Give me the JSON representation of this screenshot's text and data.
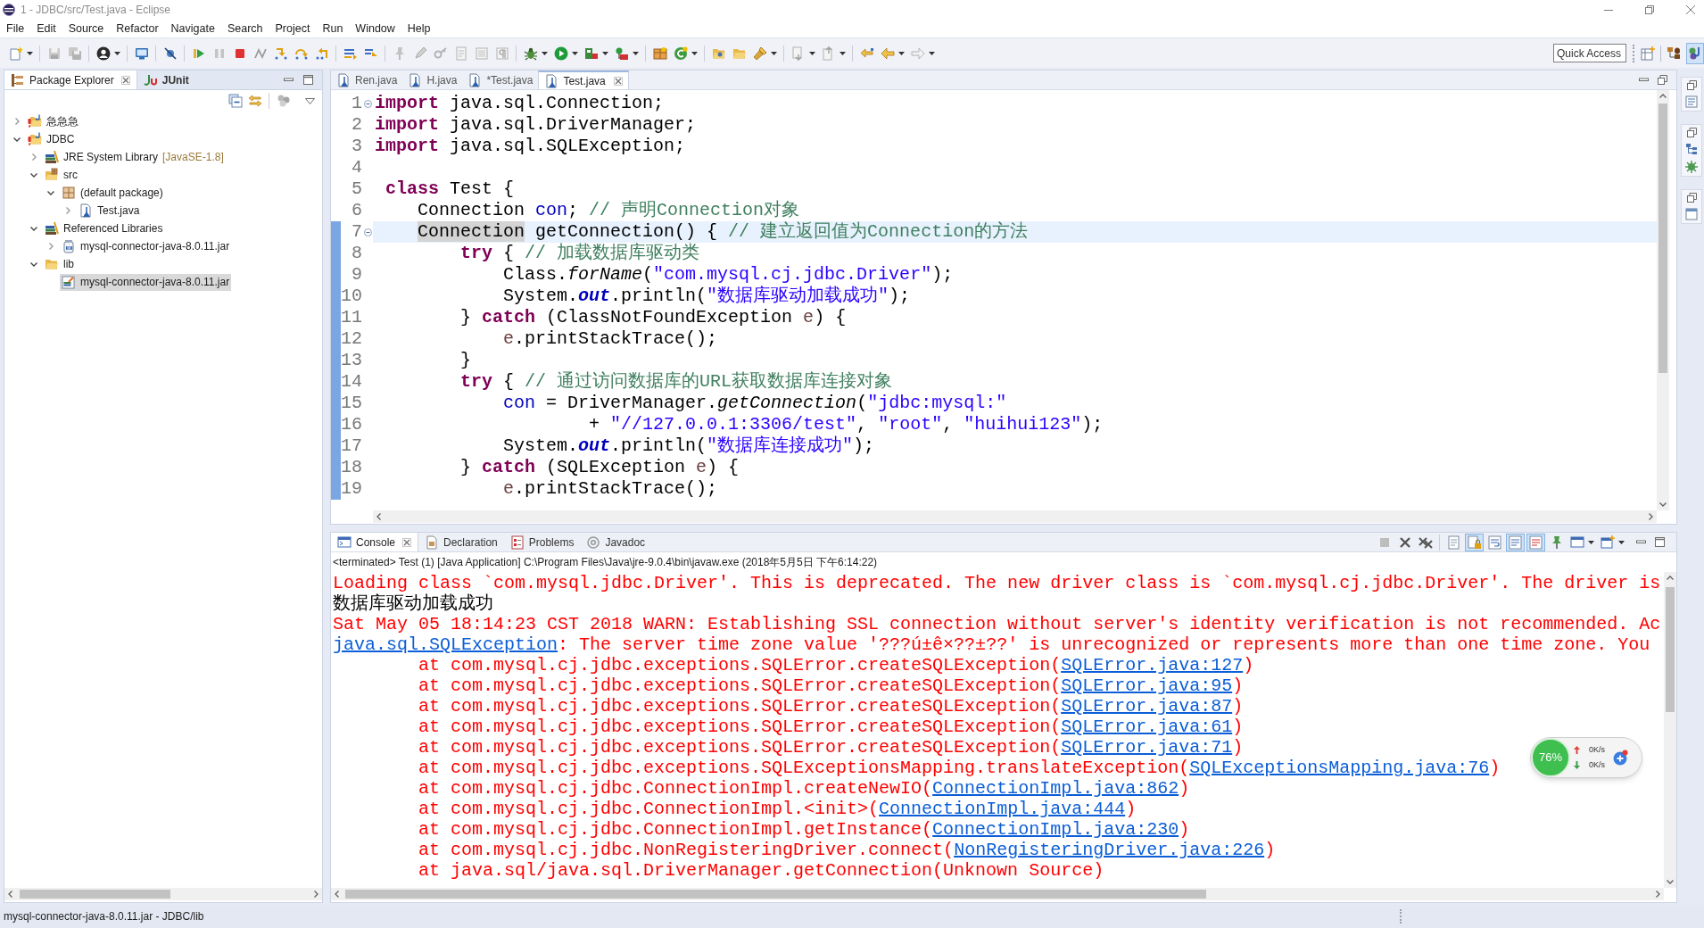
{
  "window": {
    "title": "1 - JDBC/src/Test.java - Eclipse"
  },
  "menu": [
    "File",
    "Edit",
    "Source",
    "Refactor",
    "Navigate",
    "Search",
    "Project",
    "Run",
    "Window",
    "Help"
  ],
  "quick_access": {
    "placeholder": "Quick Access"
  },
  "perspectives": [
    {
      "kind": "debug",
      "selected": false
    },
    {
      "kind": "java",
      "selected": true
    }
  ],
  "package_explorer": {
    "tabs": [
      {
        "kind": "package_explorer",
        "label": "Package Explorer",
        "selected": true,
        "bold": false
      },
      {
        "kind": "junit",
        "label": "JUnit",
        "selected": false,
        "bold": true
      }
    ],
    "tree": [
      {
        "label": "急急急",
        "kind": "project",
        "expandable": true,
        "expanded": false,
        "selected": false
      },
      {
        "label": "JDBC",
        "kind": "project",
        "expandable": true,
        "expanded": true,
        "selected": false,
        "children": [
          {
            "label": "JRE System Library",
            "decoration": "[JavaSE-1.8]",
            "kind": "library",
            "expandable": true,
            "expanded": false,
            "selected": false
          },
          {
            "label": "src",
            "kind": "source_folder",
            "expandable": true,
            "expanded": true,
            "selected": false,
            "children": [
              {
                "label": "(default package)",
                "kind": "package",
                "expandable": true,
                "expanded": true,
                "selected": false,
                "children": [
                  {
                    "label": "Test.java",
                    "kind": "java_file",
                    "expandable": true,
                    "expanded": false,
                    "selected": false
                  }
                ]
              }
            ]
          },
          {
            "label": "Referenced Libraries",
            "kind": "library",
            "expandable": true,
            "expanded": true,
            "selected": false,
            "children": [
              {
                "label": "mysql-connector-java-8.0.11.jar",
                "kind": "jar",
                "expandable": true,
                "expanded": false,
                "selected": false
              }
            ]
          },
          {
            "label": "lib",
            "kind": "folder",
            "expandable": true,
            "expanded": true,
            "selected": false,
            "children": [
              {
                "label": "mysql-connector-java-8.0.11.jar",
                "kind": "jar_file",
                "expandable": false,
                "selected": true
              }
            ]
          }
        ]
      }
    ]
  },
  "editor": {
    "tabs": [
      {
        "label": "Ren.java",
        "selected": false
      },
      {
        "label": "H.java",
        "selected": false
      },
      {
        "label": "*Test.java",
        "selected": false
      },
      {
        "label": "Test.java",
        "selected": true
      }
    ],
    "lines": [
      {
        "number": "1",
        "fold": true,
        "current": false,
        "changed": false,
        "tokens": [
          {
            "kind": "keyword",
            "text": "import"
          },
          {
            "kind": "plain",
            "text": " java.sql.Connection;"
          }
        ]
      },
      {
        "number": "2",
        "fold": false,
        "current": false,
        "changed": false,
        "tokens": [
          {
            "kind": "keyword",
            "text": "import"
          },
          {
            "kind": "plain",
            "text": " java.sql.DriverManager;"
          }
        ]
      },
      {
        "number": "3",
        "fold": false,
        "current": false,
        "changed": false,
        "tokens": [
          {
            "kind": "keyword",
            "text": "import"
          },
          {
            "kind": "plain",
            "text": " java.sql.SQLException;"
          }
        ]
      },
      {
        "number": "4",
        "fold": false,
        "current": false,
        "changed": false
      },
      {
        "number": "5",
        "fold": false,
        "current": false,
        "changed": false,
        "tokens": [
          {
            "kind": "keyword",
            "text": " class"
          },
          {
            "kind": "plain",
            "text": " Test {"
          }
        ]
      },
      {
        "number": "6",
        "fold": false,
        "current": false,
        "changed": false,
        "tokens": [
          {
            "kind": "plain",
            "text": "    Connection "
          },
          {
            "kind": "field",
            "text": "con"
          },
          {
            "kind": "plain",
            "text": "; "
          },
          {
            "kind": "comment",
            "text": "// 声明Connection对象"
          }
        ]
      },
      {
        "number": "7",
        "fold": true,
        "current": true,
        "changed": true,
        "tokens": [
          {
            "kind": "occurrence",
            "text": "    Connection"
          },
          {
            "kind": "plain",
            "text": " getConnection() { "
          },
          {
            "kind": "comment",
            "text": "// 建立返回值为Connection的方法"
          }
        ]
      },
      {
        "number": "8",
        "fold": false,
        "current": false,
        "changed": true,
        "tokens": [
          {
            "kind": "keyword",
            "text": "        try"
          },
          {
            "kind": "plain",
            "text": " { "
          },
          {
            "kind": "comment",
            "text": "// 加载数据库驱动类"
          }
        ]
      },
      {
        "number": "9",
        "fold": false,
        "current": false,
        "changed": true,
        "tokens": [
          {
            "kind": "plain",
            "text": "            Class."
          },
          {
            "kind": "static_method",
            "text": "forName"
          },
          {
            "kind": "plain",
            "text": "("
          },
          {
            "kind": "string",
            "text": "\"com.mysql.cj.jdbc.Driver\""
          },
          {
            "kind": "plain",
            "text": ");"
          }
        ]
      },
      {
        "number": "10",
        "fold": false,
        "current": false,
        "changed": true,
        "tokens": [
          {
            "kind": "plain",
            "text": "            System."
          },
          {
            "kind": "static_field",
            "text": "out"
          },
          {
            "kind": "plain",
            "text": ".println("
          },
          {
            "kind": "string",
            "text": "\"数据库驱动加载成功\""
          },
          {
            "kind": "plain",
            "text": ");"
          }
        ]
      },
      {
        "number": "11",
        "fold": false,
        "current": false,
        "changed": true,
        "tokens": [
          {
            "kind": "plain",
            "text": "        } "
          },
          {
            "kind": "keyword",
            "text": "catch"
          },
          {
            "kind": "plain",
            "text": " (ClassNotFoundException "
          },
          {
            "kind": "local",
            "text": "e"
          },
          {
            "kind": "plain",
            "text": ") {"
          }
        ]
      },
      {
        "number": "12",
        "fold": false,
        "current": false,
        "changed": true,
        "tokens": [
          {
            "kind": "local",
            "text": "            e"
          },
          {
            "kind": "plain",
            "text": ".printStackTrace();"
          }
        ]
      },
      {
        "number": "13",
        "fold": false,
        "current": false,
        "changed": true,
        "tokens": [
          {
            "kind": "plain",
            "text": "        }"
          }
        ]
      },
      {
        "number": "14",
        "fold": false,
        "current": false,
        "changed": true,
        "tokens": [
          {
            "kind": "keyword",
            "text": "        try"
          },
          {
            "kind": "plain",
            "text": " { "
          },
          {
            "kind": "comment",
            "text": "// 通过访问数据库的URL获取数据库连接对象"
          }
        ]
      },
      {
        "number": "15",
        "fold": false,
        "current": false,
        "changed": true,
        "tokens": [
          {
            "kind": "field",
            "text": "            con"
          },
          {
            "kind": "plain",
            "text": " = DriverManager."
          },
          {
            "kind": "static_method",
            "text": "getConnection"
          },
          {
            "kind": "plain",
            "text": "("
          },
          {
            "kind": "string",
            "text": "\"jdbc:mysql:\""
          }
        ]
      },
      {
        "number": "16",
        "fold": false,
        "current": false,
        "changed": true,
        "tokens": [
          {
            "kind": "plain",
            "text": "                    + "
          },
          {
            "kind": "string",
            "text": "\"//127.0.0.1:3306/test\""
          },
          {
            "kind": "plain",
            "text": ", "
          },
          {
            "kind": "string",
            "text": "\"root\""
          },
          {
            "kind": "plain",
            "text": ", "
          },
          {
            "kind": "string",
            "text": "\"huihui123\""
          },
          {
            "kind": "plain",
            "text": ");"
          }
        ]
      },
      {
        "number": "17",
        "fold": false,
        "current": false,
        "changed": true,
        "tokens": [
          {
            "kind": "plain",
            "text": "            System."
          },
          {
            "kind": "static_field",
            "text": "out"
          },
          {
            "kind": "plain",
            "text": ".println("
          },
          {
            "kind": "string",
            "text": "\"数据库连接成功\""
          },
          {
            "kind": "plain",
            "text": ");"
          }
        ]
      },
      {
        "number": "18",
        "fold": false,
        "current": false,
        "changed": true,
        "tokens": [
          {
            "kind": "plain",
            "text": "        } "
          },
          {
            "kind": "keyword",
            "text": "catch"
          },
          {
            "kind": "plain",
            "text": " (SQLException "
          },
          {
            "kind": "local",
            "text": "e"
          },
          {
            "kind": "plain",
            "text": ") {"
          }
        ]
      },
      {
        "number": "19",
        "fold": false,
        "current": false,
        "changed": true,
        "tokens": [
          {
            "kind": "local",
            "text": "            e"
          },
          {
            "kind": "plain",
            "text": ".printStackTrace();"
          }
        ]
      }
    ]
  },
  "console": {
    "tabs": [
      {
        "kind": "console",
        "label": "Console",
        "selected": true
      },
      {
        "kind": "declaration",
        "label": "Declaration",
        "selected": false
      },
      {
        "kind": "problems",
        "label": "Problems",
        "selected": false
      },
      {
        "kind": "javadoc",
        "label": "Javadoc",
        "selected": false
      }
    ],
    "toggles": [
      {
        "kind": "scroll_lock",
        "selected": true
      },
      {
        "kind": "word_wrap",
        "selected": false
      },
      {
        "kind": "stdout",
        "selected": true
      },
      {
        "kind": "stderr",
        "selected": true
      },
      {
        "kind": "pin",
        "selected": false
      }
    ],
    "process": "<terminated> Test (1) [Java Application] C:\\Program Files\\Java\\jre-9.0.4\\bin\\javaw.exe (2018年5月5日 下午6:14:22)",
    "lines": [
      {
        "segments": [
          {
            "kind": "error",
            "text": "Loading class `com.mysql.jdbc.Driver'. This is deprecated. The new driver class is `com.mysql.cj.jdbc.Driver'. The driver is"
          }
        ]
      },
      {
        "segments": [
          {
            "kind": "output",
            "text": "数据库驱动加载成功"
          }
        ]
      },
      {
        "segments": [
          {
            "kind": "error",
            "text": "Sat May 05 18:14:23 CST 2018 WARN: Establishing SSL connection without server's identity verification is not recommended. Ac"
          }
        ]
      },
      {
        "segments": [
          {
            "kind": "link",
            "text": "java.sql.SQLException"
          },
          {
            "kind": "error",
            "text": ": The server time zone value '???ú±ê×??±??' is unrecognized or represents more than one time zone. You"
          }
        ]
      },
      {
        "segments": [
          {
            "kind": "error",
            "text": "\tat com.mysql.cj.jdbc.exceptions.SQLError.createSQLException("
          },
          {
            "kind": "link",
            "text": "SQLError.java:127"
          },
          {
            "kind": "error",
            "text": ")"
          }
        ]
      },
      {
        "segments": [
          {
            "kind": "error",
            "text": "\tat com.mysql.cj.jdbc.exceptions.SQLError.createSQLException("
          },
          {
            "kind": "link",
            "text": "SQLError.java:95"
          },
          {
            "kind": "error",
            "text": ")"
          }
        ]
      },
      {
        "segments": [
          {
            "kind": "error",
            "text": "\tat com.mysql.cj.jdbc.exceptions.SQLError.createSQLException("
          },
          {
            "kind": "link",
            "text": "SQLError.java:87"
          },
          {
            "kind": "error",
            "text": ")"
          }
        ]
      },
      {
        "segments": [
          {
            "kind": "error",
            "text": "\tat com.mysql.cj.jdbc.exceptions.SQLError.createSQLException("
          },
          {
            "kind": "link",
            "text": "SQLError.java:61"
          },
          {
            "kind": "error",
            "text": ")"
          }
        ]
      },
      {
        "segments": [
          {
            "kind": "error",
            "text": "\tat com.mysql.cj.jdbc.exceptions.SQLError.createSQLException("
          },
          {
            "kind": "link",
            "text": "SQLError.java:71"
          },
          {
            "kind": "error",
            "text": ")"
          }
        ]
      },
      {
        "segments": [
          {
            "kind": "error",
            "text": "\tat com.mysql.cj.jdbc.exceptions.SQLExceptionsMapping.translateException("
          },
          {
            "kind": "link",
            "text": "SQLExceptionsMapping.java:76"
          },
          {
            "kind": "error",
            "text": ")"
          }
        ]
      },
      {
        "segments": [
          {
            "kind": "error",
            "text": "\tat com.mysql.cj.jdbc.ConnectionImpl.createNewIO("
          },
          {
            "kind": "link",
            "text": "ConnectionImpl.java:862"
          },
          {
            "kind": "error",
            "text": ")"
          }
        ]
      },
      {
        "segments": [
          {
            "kind": "error",
            "text": "\tat com.mysql.cj.jdbc.ConnectionImpl.<init>("
          },
          {
            "kind": "link",
            "text": "ConnectionImpl.java:444"
          },
          {
            "kind": "error",
            "text": ")"
          }
        ]
      },
      {
        "segments": [
          {
            "kind": "error",
            "text": "\tat com.mysql.cj.jdbc.ConnectionImpl.getInstance("
          },
          {
            "kind": "link",
            "text": "ConnectionImpl.java:230"
          },
          {
            "kind": "error",
            "text": ")"
          }
        ]
      },
      {
        "segments": [
          {
            "kind": "error",
            "text": "\tat com.mysql.cj.jdbc.NonRegisteringDriver.connect("
          },
          {
            "kind": "link",
            "text": "NonRegisteringDriver.java:226"
          },
          {
            "kind": "error",
            "text": ")"
          }
        ]
      },
      {
        "segments": [
          {
            "kind": "error",
            "text": "\tat java.sql/java.sql.DriverManager.getConnection(Unknown Source)"
          }
        ]
      }
    ]
  },
  "status_bar": {
    "text": "mysql-connector-java-8.0.11.jar - JDBC/lib"
  },
  "network_monitor": {
    "usage": "76%",
    "upload": "0K/s",
    "download": "0K/s"
  }
}
